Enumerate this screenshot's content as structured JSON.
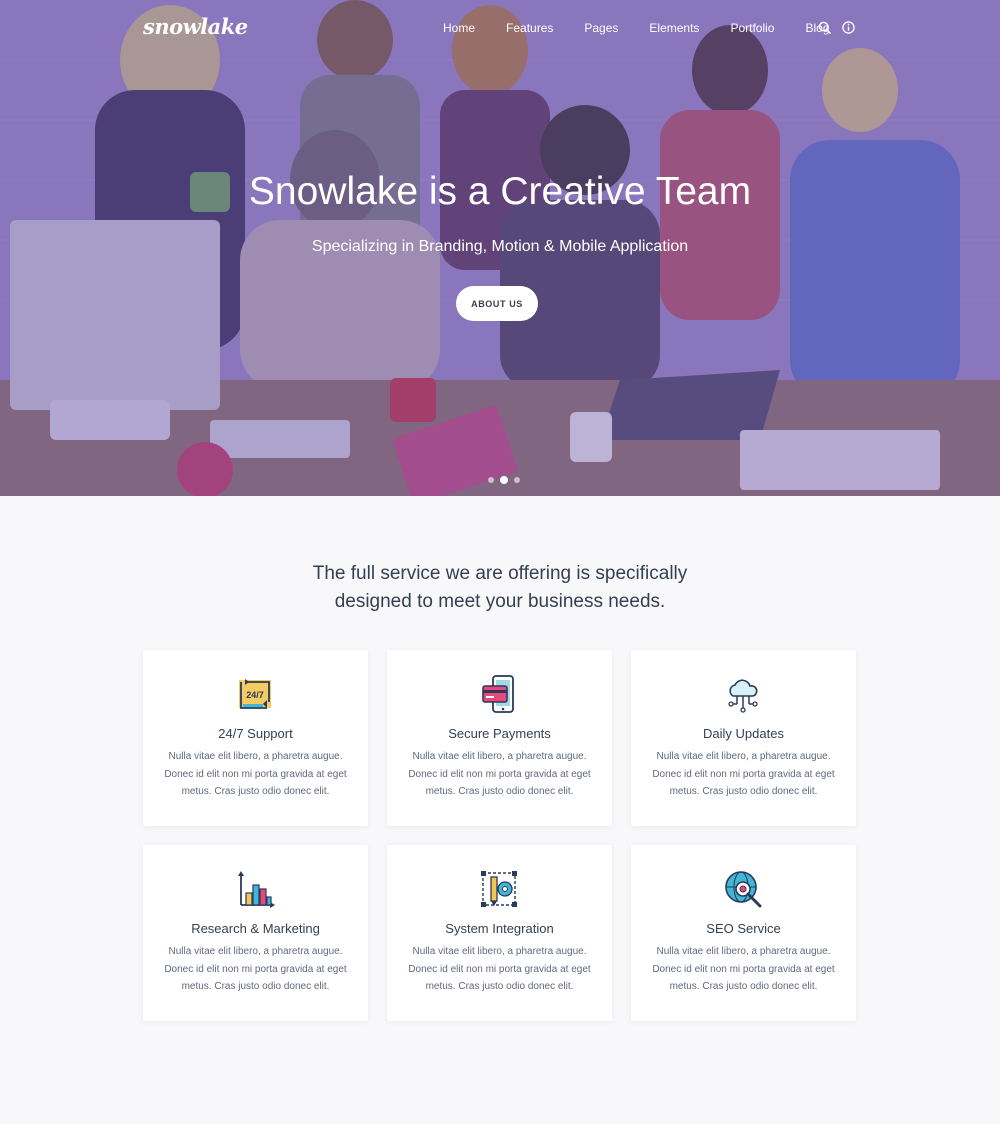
{
  "brand": {
    "logo": "snowlake"
  },
  "nav": {
    "items": [
      "Home",
      "Features",
      "Pages",
      "Elements",
      "Portfolio",
      "Blog"
    ],
    "icons": [
      "search-icon",
      "info-icon"
    ]
  },
  "hero": {
    "title": "Snowlake is a Creative Team",
    "subtitle": "Specializing in Branding, Motion & Mobile Application",
    "button": "ABOUT US",
    "slides": 3,
    "active_slide": 2
  },
  "services": {
    "intro_line1": "The full service we are offering is specifically",
    "intro_line2": "designed to meet your business needs.",
    "cards": [
      {
        "title": "24/7 Support",
        "icon": "support-247-icon",
        "desc": "Nulla vitae elit libero, a pharetra augue. Donec id elit non mi porta gravida at eget metus. Cras justo odio donec elit."
      },
      {
        "title": "Secure Payments",
        "icon": "secure-payment-icon",
        "desc": "Nulla vitae elit libero, a pharetra augue. Donec id elit non mi porta gravida at eget metus. Cras justo odio donec elit."
      },
      {
        "title": "Daily Updates",
        "icon": "cloud-network-icon",
        "desc": "Nulla vitae elit libero, a pharetra augue. Donec id elit non mi porta gravida at eget metus. Cras justo odio donec elit."
      },
      {
        "title": "Research & Marketing",
        "icon": "bar-chart-icon",
        "desc": "Nulla vitae elit libero, a pharetra augue. Donec id elit non mi porta gravida at eget metus. Cras justo odio donec elit."
      },
      {
        "title": "System Integration",
        "icon": "integration-icon",
        "desc": "Nulla vitae elit libero, a pharetra augue. Donec id elit non mi porta gravida at eget metus. Cras justo odio donec elit."
      },
      {
        "title": "SEO Service",
        "icon": "seo-globe-icon",
        "desc": "Nulla vitae elit libero, a pharetra augue. Donec id elit non mi porta gravida at eget metus. Cras justo odio donec elit."
      }
    ]
  },
  "colors": {
    "overlay": "#7a64ab",
    "heading": "#343f52",
    "text": "#60697b",
    "background": "#f8f8fb"
  }
}
